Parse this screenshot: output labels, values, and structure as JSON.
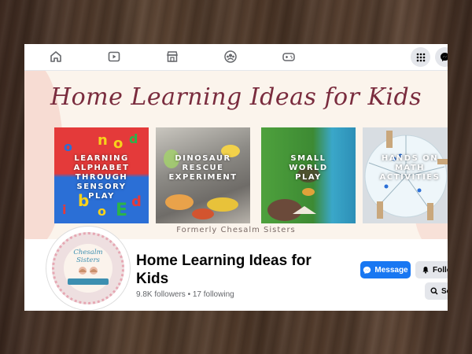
{
  "nav": {
    "icons": [
      "home-icon",
      "watch-icon",
      "marketplace-icon",
      "groups-icon",
      "gaming-icon",
      "menu-grid-icon",
      "messenger-icon"
    ]
  },
  "cover": {
    "title": "Home Learning Ideas for Kids",
    "tiles": [
      {
        "label_lines": [
          "LEARNING",
          "ALPHABET",
          "THROUGH",
          "SENSORY",
          "PLAY"
        ]
      },
      {
        "label_lines": [
          "DINOSAUR",
          "RESCUE",
          "EXPERIMENT"
        ]
      },
      {
        "label_lines": [
          "SMALL",
          "WORLD",
          "PLAY"
        ]
      },
      {
        "label_lines": [
          "HANDS ON",
          "MATH",
          "ACTIVITIES"
        ]
      }
    ],
    "formerly": "Formerly Chesalm Sisters"
  },
  "profile": {
    "avatar_text": "Chesalm Sisters",
    "name_line1": "Home Learning Ideas for",
    "name_line2": "Kids",
    "followers": "9.8K followers",
    "separator": " • ",
    "following": "17 following"
  },
  "actions": {
    "message_label": "Message",
    "follow_label": "Follo",
    "search_label": "Se"
  },
  "colors": {
    "brand_blue": "#1877f2",
    "title_maroon": "#7a2c3e"
  }
}
